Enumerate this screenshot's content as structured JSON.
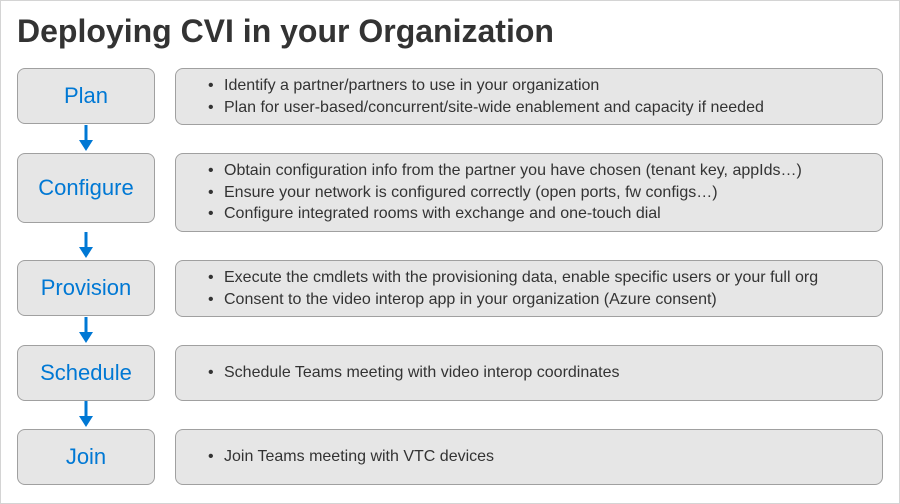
{
  "title": "Deploying CVI in your Organization",
  "steps": [
    {
      "label": "Plan",
      "height": "tall1",
      "details": [
        "Identify a partner/partners to use in your organization",
        "Plan for user-based/concurrent/site-wide enablement and capacity if needed"
      ]
    },
    {
      "label": "Configure",
      "height": "tall2",
      "details": [
        "Obtain configuration info from the partner you have chosen (tenant key, appIds…)",
        "Ensure your network is configured correctly (open ports, fw configs…)",
        "Configure integrated rooms with exchange and one-touch dial"
      ]
    },
    {
      "label": "Provision",
      "height": "tall1",
      "details": [
        "Execute the cmdlets with the provisioning data, enable specific users or your full org",
        "Consent to the video interop app in your organization (Azure consent)"
      ]
    },
    {
      "label": "Schedule",
      "height": "tall1",
      "details": [
        "Schedule Teams meeting with video interop coordinates"
      ]
    },
    {
      "label": "Join",
      "height": "tall1",
      "details": [
        "Join Teams meeting with VTC devices"
      ]
    }
  ]
}
